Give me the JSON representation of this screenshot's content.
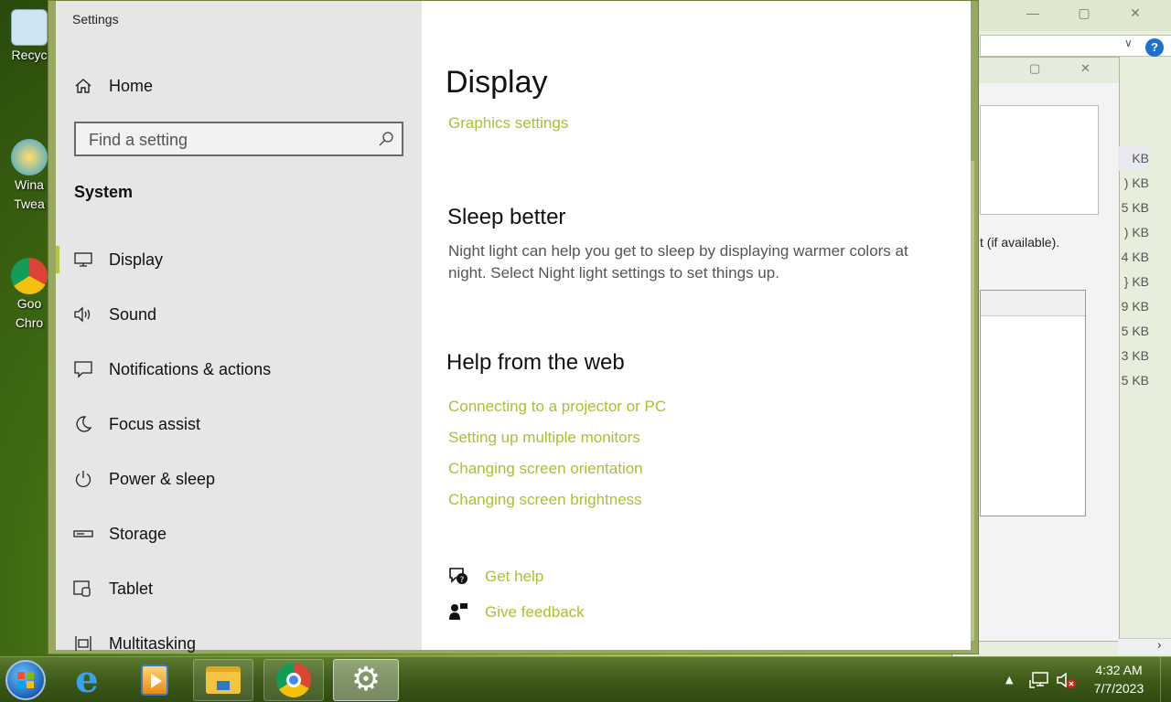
{
  "desktop": {
    "icons": [
      {
        "label": "Recyc"
      },
      {
        "label": "Wina Twea"
      },
      {
        "label": "Goo Chro"
      }
    ]
  },
  "background_window": {
    "status_text": "t (if available).",
    "sizes": [
      "KB",
      ") KB",
      "5 KB",
      ") KB",
      "4 KB",
      "} KB",
      "9 KB",
      "5 KB",
      "3 KB",
      "5 KB"
    ]
  },
  "settings": {
    "window_title": "Settings",
    "nav": {
      "home": "Home",
      "search_placeholder": "Find a setting",
      "section": "System",
      "items": [
        {
          "label": "Display",
          "icon": "monitor-icon"
        },
        {
          "label": "Sound",
          "icon": "speaker-icon"
        },
        {
          "label": "Notifications & actions",
          "icon": "notification-icon"
        },
        {
          "label": "Focus assist",
          "icon": "moon-icon"
        },
        {
          "label": "Power & sleep",
          "icon": "power-icon"
        },
        {
          "label": "Storage",
          "icon": "storage-icon"
        },
        {
          "label": "Tablet",
          "icon": "tablet-icon"
        },
        {
          "label": "Multitasking",
          "icon": "multitasking-icon"
        }
      ],
      "active": "Display"
    },
    "content": {
      "title": "Display",
      "graphics_link": "Graphics settings",
      "sleep_heading": "Sleep better",
      "sleep_text": "Night light can help you get to sleep by displaying warmer colors at night. Select Night light settings to set things up.",
      "help_heading": "Help from the web",
      "help_links": [
        "Connecting to a projector or PC",
        "Setting up multiple monitors",
        "Changing screen orientation",
        "Changing screen brightness"
      ],
      "get_help": "Get help",
      "give_feedback": "Give feedback"
    },
    "accent_color": "#a9c22e"
  },
  "taskbar": {
    "apps": [
      "internet-explorer-icon",
      "media-player-icon",
      "file-explorer-icon",
      "chrome-icon",
      "settings-gear-icon"
    ],
    "time": "4:32 AM",
    "date": "7/7/2023"
  }
}
